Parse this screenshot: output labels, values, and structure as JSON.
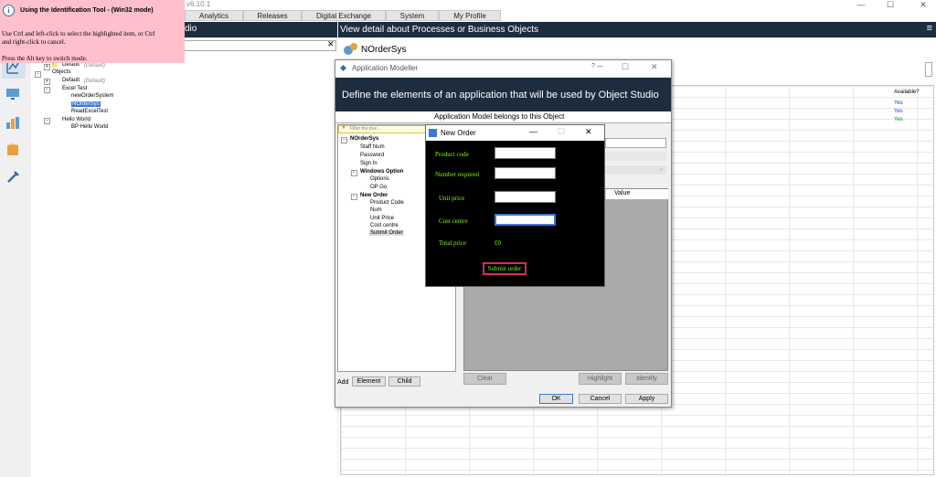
{
  "app": {
    "version": "v6.10.1"
  },
  "nav_tabs": [
    "Analytics",
    "Releases",
    "Digital Exchange",
    "System",
    "My Profile"
  ],
  "tooltip": {
    "title": "Using the Identification Tool - (Win32 mode)",
    "line1": "Use Ctrl and left-click to select the highlighted item, or Ctrl",
    "line2": "and right-click to cancel.",
    "line3": "Press the Alt key to switch mode."
  },
  "left_panel": {
    "header": "dio",
    "tree": [
      {
        "label": "Default",
        "sub": "(Default)"
      },
      {
        "label": "Objects"
      },
      {
        "label": "Default",
        "sub": "(Default)"
      },
      {
        "label": "Excel Test"
      },
      {
        "label": "newOrderSystem"
      },
      {
        "label": "NOrderSys"
      },
      {
        "label": "ReadExcelTest"
      },
      {
        "label": "Hello World"
      },
      {
        "label": "BP Hello World"
      }
    ]
  },
  "right_panel": {
    "header": "View detail about Processes or Business Objects",
    "object_name": "NOrderSys",
    "grid_column": "Available?",
    "grid_values": [
      "Yes",
      "Yes",
      "Yes"
    ]
  },
  "app_modeller": {
    "title": "Application Modeller",
    "help": "? —",
    "banner": "Define the elements of an application that will be used by Object Studio",
    "model_belongs": "Application Model belongs to this Object",
    "filter_placeholder": "Filter the tree...",
    "tree": [
      {
        "label": "NOrderSys",
        "level": 0,
        "bold": true
      },
      {
        "label": "Staff Num",
        "level": 1
      },
      {
        "label": "Password",
        "level": 1
      },
      {
        "label": "Sign In",
        "level": 1
      },
      {
        "label": "Windows Option",
        "level": 1,
        "bold": true
      },
      {
        "label": "Options",
        "level": 2
      },
      {
        "label": "OP Go",
        "level": 2
      },
      {
        "label": "New Order",
        "level": 1,
        "bold": true
      },
      {
        "label": "Product Code",
        "level": 2
      },
      {
        "label": "Num",
        "level": 2
      },
      {
        "label": "Unit Price",
        "level": 2
      },
      {
        "label": "Cost centre",
        "level": 2
      },
      {
        "label": "Submit Order",
        "level": 2,
        "selected": true
      }
    ],
    "value_header": "Value",
    "add_label": "Add",
    "element_btn": "Element",
    "child_btn": "Child",
    "clear_btn": "Clear",
    "highlight_btn": "Highlight",
    "identify_btn": "Identify",
    "ok_btn": "OK",
    "cancel_btn": "Cancel",
    "apply_btn": "Apply"
  },
  "new_order": {
    "title": "New Order",
    "fields": [
      {
        "label": "Product code",
        "value": ""
      },
      {
        "label": "Number required",
        "value": ""
      },
      {
        "label": "Unit price",
        "value": ""
      },
      {
        "label": "Cost centre",
        "value": ""
      }
    ],
    "total_label": "Total price",
    "total_value": "£0",
    "submit": "Submit order"
  },
  "colors": {
    "dark_header": "#1d2d3e",
    "tooltip_bg": "#ffc0cb",
    "green_text": "#7cfc00",
    "submit_border": "#e0245e"
  }
}
